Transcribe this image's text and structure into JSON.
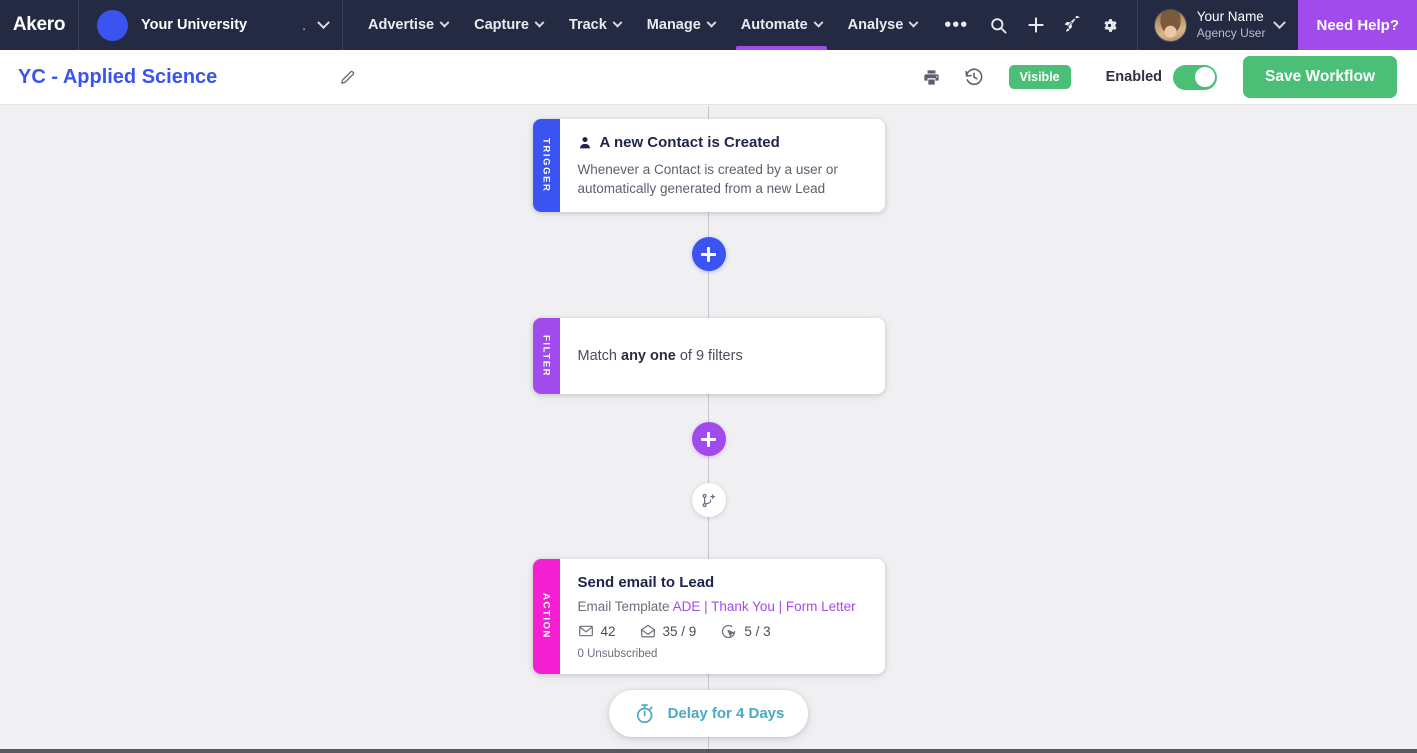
{
  "topnav": {
    "brand": "Akero",
    "org": {
      "name": "Your University",
      "dot": ".",
      "avatar_color": "#3b53f0"
    },
    "menu": [
      {
        "label": "Advertise",
        "active": false
      },
      {
        "label": "Capture",
        "active": false
      },
      {
        "label": "Track",
        "active": false
      },
      {
        "label": "Manage",
        "active": false
      },
      {
        "label": "Automate",
        "active": true
      },
      {
        "label": "Analyse",
        "active": false
      }
    ],
    "overflow": "•••",
    "icons": [
      "search-icon",
      "plus-icon",
      "rocket-icon",
      "gear-icon"
    ],
    "user": {
      "name": "Your Name",
      "role": "Agency User"
    },
    "need_help": "Need Help?",
    "accent": "#a24bec",
    "background": "#242a41"
  },
  "workflow_bar": {
    "title": "YC - Applied Science",
    "edit_icon": "pencil-icon",
    "print_icon": "printer-icon",
    "history_icon": "history-icon",
    "visibility_badge": "Visible",
    "enabled_label": "Enabled",
    "enabled_state": "on",
    "save_label": "Save Workflow",
    "green": "#4cbf76",
    "title_color": "#3b53f0"
  },
  "canvas": {
    "background": "#f0f0f2",
    "nodes": [
      {
        "type": "trigger",
        "tab_label": "TRIGGER",
        "tab_color": "#3b53f0",
        "icon": "person-icon",
        "title": "A new Contact is Created",
        "description": "Whenever a Contact is created by a user or automatically generated from a new Lead"
      },
      {
        "type": "filter",
        "tab_label": "FILTER",
        "tab_color": "#a24bec",
        "text_prefix": "Match ",
        "text_bold": "any one",
        "text_suffix": " of 9 filters"
      },
      {
        "type": "action",
        "tab_label": "ACTION",
        "tab_color": "#f41fd2",
        "title": "Send email to Lead",
        "template_label": "Email Template ",
        "template_name": "ADE | Thank You | Form Letter",
        "stats": [
          {
            "icon": "envelope-sent-icon",
            "value": "42"
          },
          {
            "icon": "envelope-open-icon",
            "value": "35 / 9"
          },
          {
            "icon": "click-cursor-icon",
            "value": "5 / 3"
          }
        ],
        "unsubscribed": "0 Unsubscribed"
      }
    ],
    "add_button_blue": "+",
    "add_button_purple": "+",
    "branch_icon": "branch-add-icon",
    "delay": {
      "icon": "stopwatch-icon",
      "label": "Delay for 4 Days",
      "color": "#4aa9c4"
    }
  }
}
